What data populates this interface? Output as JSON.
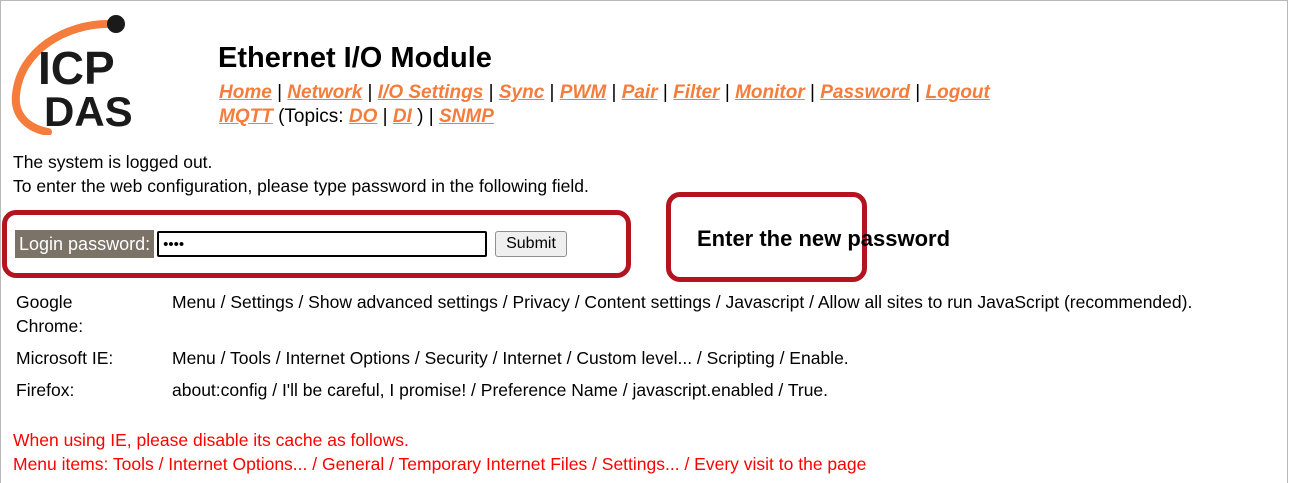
{
  "logo": {
    "line1": "ICP",
    "line2": "DAS"
  },
  "page_title": "Ethernet I/O Module",
  "nav": {
    "row1": [
      "Home",
      "Network",
      "I/O Settings",
      "Sync",
      "PWM",
      "Pair",
      "Filter",
      "Monitor",
      "Password",
      "Logout"
    ],
    "row2": {
      "mqtt": "MQTT",
      "topics_prefix": "(Topics: ",
      "do": "DO",
      "di": "DI",
      "topics_suffix": ")",
      "snmp": "SNMP"
    },
    "separator": "|"
  },
  "message": {
    "line1": "The system is logged out.",
    "line2": "To enter the web configuration, please type password in the following field."
  },
  "login": {
    "label": "Login password:",
    "value": "1234",
    "submit": "Submit"
  },
  "callout": {
    "text": "Enter the new password"
  },
  "browsers": [
    {
      "name": "Google Chrome:",
      "steps": "Menu / Settings / Show advanced settings / Privacy / Content settings / Javascript / Allow all sites to run JavaScript (recommended)."
    },
    {
      "name": "Microsoft IE:",
      "steps": "Menu / Tools / Internet Options / Security / Internet / Custom level... / Scripting / Enable."
    },
    {
      "name": "Firefox:",
      "steps": "about:config / I'll be careful, I promise! / Preference Name / javascript.enabled / True."
    }
  ],
  "warning": {
    "line1": "When using IE, please disable its cache as follows.",
    "line2": "Menu items: Tools / Internet Options... / General / Temporary Internet Files / Settings... / Every visit to the page"
  },
  "colors": {
    "nav_link": "#f47c3c",
    "callout_border": "#b3141f",
    "warning": "#ff0000",
    "label_bg": "#7b7367"
  }
}
